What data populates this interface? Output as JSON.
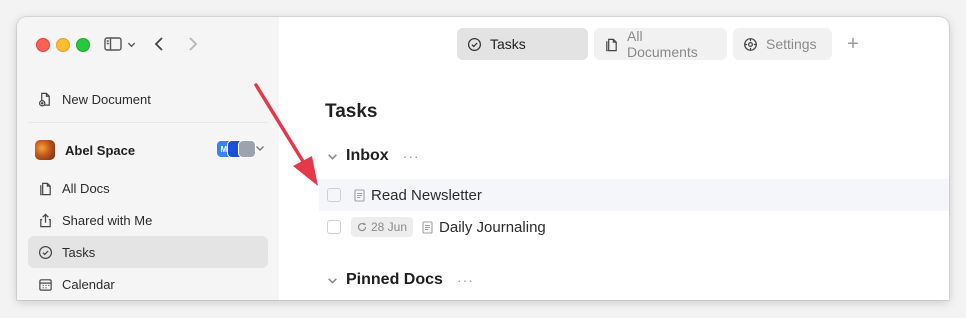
{
  "titlebar": {
    "tabs": [
      {
        "label": "Tasks",
        "icon": "check-circle-icon",
        "active": true
      },
      {
        "label": "All Documents",
        "icon": "documents-icon",
        "active": false
      },
      {
        "label": "Settings",
        "icon": "gear-icon",
        "active": false
      }
    ],
    "add_tab_label": "+"
  },
  "sidebar": {
    "new_document_label": "New Document",
    "workspace": {
      "name": "Abel Space",
      "members": [
        "MI",
        "",
        ""
      ]
    },
    "items": [
      {
        "label": "All Docs",
        "icon": "documents-icon"
      },
      {
        "label": "Shared with Me",
        "icon": "share-icon"
      },
      {
        "label": "Tasks",
        "icon": "check-circle-icon",
        "selected": true
      },
      {
        "label": "Calendar",
        "icon": "calendar-icon"
      }
    ]
  },
  "main": {
    "page_title": "Tasks",
    "sections": [
      {
        "title": "Inbox",
        "more": "···",
        "tasks": [
          {
            "text": "Read Newsletter"
          },
          {
            "text": "Daily Journaling",
            "date": "28 Jun"
          }
        ]
      },
      {
        "title": "Pinned Docs",
        "more": "···"
      }
    ]
  },
  "colors": {
    "annotation_arrow": "#e5384a",
    "selected_bg": "#e4e4e4",
    "active_tab_bg": "#e3e3e3"
  }
}
